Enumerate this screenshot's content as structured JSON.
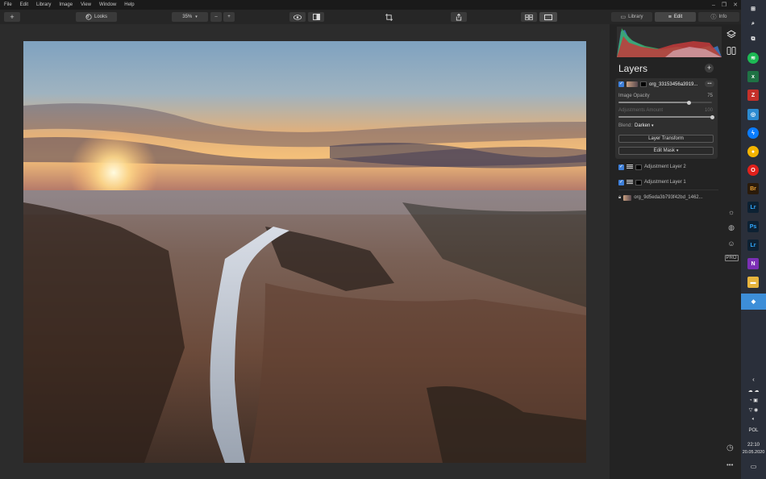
{
  "menu": [
    "File",
    "Edit",
    "Library",
    "Image",
    "View",
    "Window",
    "Help"
  ],
  "window_controls": {
    "minimize": "–",
    "restore": "❐",
    "close": "✕"
  },
  "toolbar": {
    "add_label": "+",
    "looks_label": "Looks",
    "zoom_value": "35%",
    "zoom_out": "–",
    "zoom_in": "+"
  },
  "panel": {
    "tabs": [
      {
        "label": "Library",
        "icon": "library-icon"
      },
      {
        "label": "Edit",
        "icon": "sliders-icon"
      },
      {
        "label": "Info",
        "icon": "info-icon"
      }
    ],
    "layers_title": "Layers",
    "add_layer": "+",
    "active_layer": {
      "name": "org_33153456a3919...",
      "more": "•••",
      "image_opacity_label": "Image Opacity",
      "image_opacity_value": "75",
      "image_opacity": 0.75,
      "adjustments_amount_label": "Adjustments Amount",
      "adjustments_amount_value": "100",
      "adjustments_amount": 1.0,
      "blend_label": "Blend:",
      "blend_value": "Darken",
      "layer_transform_label": "Layer Transform",
      "edit_mask_label": "Edit Mask"
    },
    "layers": [
      {
        "name": "Adjustment Layer 2"
      },
      {
        "name": "Adjustment Layer 1"
      },
      {
        "name": "org_9d5eda3b793f42bd_1462..."
      }
    ],
    "pro_label": "PRO"
  },
  "taskbar": {
    "language": "POL",
    "time": "22:10",
    "date": "20.05.2020"
  },
  "colors": {
    "accent": "#3d7fd9",
    "panel_bg": "#232323",
    "canvas_bg": "#2c2c2c"
  }
}
